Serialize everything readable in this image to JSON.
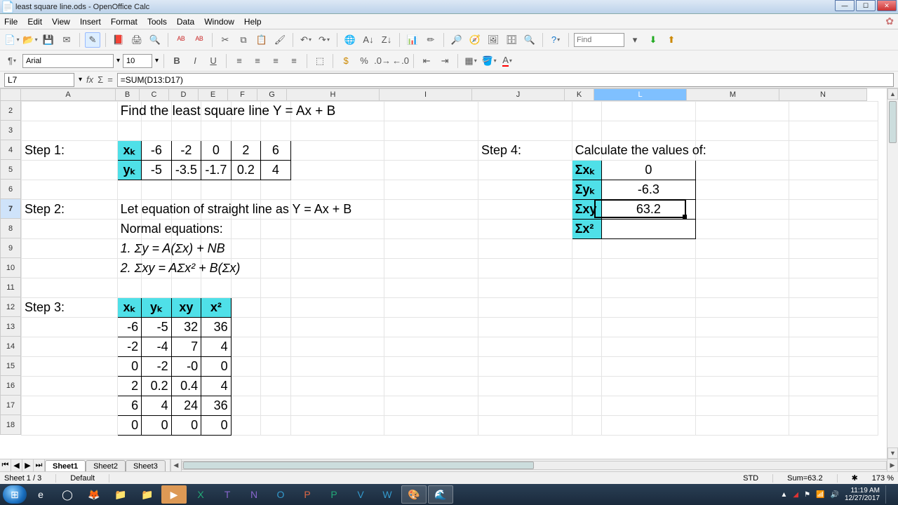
{
  "window": {
    "title": "least square line.ods - OpenOffice Calc"
  },
  "menu": [
    "File",
    "Edit",
    "View",
    "Insert",
    "Format",
    "Tools",
    "Data",
    "Window",
    "Help"
  ],
  "toolbar2": {
    "font_name": "Arial",
    "font_size": "10"
  },
  "find_placeholder": "Find",
  "namebox": "L7",
  "formula": "=SUM(D13:D17)",
  "columns": [
    {
      "l": "A",
      "w": 135
    },
    {
      "l": "B",
      "w": 34
    },
    {
      "l": "C",
      "w": 42
    },
    {
      "l": "D",
      "w": 42
    },
    {
      "l": "E",
      "w": 42
    },
    {
      "l": "F",
      "w": 42
    },
    {
      "l": "G",
      "w": 42
    },
    {
      "l": "H",
      "w": 132
    },
    {
      "l": "I",
      "w": 132
    },
    {
      "l": "J",
      "w": 132
    },
    {
      "l": "K",
      "w": 42
    },
    {
      "l": "L",
      "w": 132
    },
    {
      "l": "M",
      "w": 132
    },
    {
      "l": "N",
      "w": 125
    }
  ],
  "rows": [
    2,
    3,
    4,
    5,
    6,
    7,
    8,
    9,
    10,
    11,
    12,
    13,
    14,
    15,
    16,
    17,
    18
  ],
  "selected_row_index": 5,
  "selected_col": "L",
  "content": {
    "title_text": "Find the least square line Y = Ax + B",
    "step1_label": "Step 1:",
    "step1_xh": "xₖ",
    "step1_yh": "yₖ",
    "step1_x": [
      "-6",
      "-2",
      "0",
      "2",
      "6"
    ],
    "step1_y": [
      "-5",
      "-3.5",
      "-1.7",
      "0.2",
      "4"
    ],
    "step2_label": "Step 2:",
    "step2_l1": "Let equation of straight line as Y = Ax + B",
    "step2_l2": "Normal equations:",
    "step2_l3": "1. Σy = A(Σx) + NB",
    "step2_l4": "2. Σxy = AΣx² + B(Σx)",
    "step3_label": "Step 3:",
    "step3_heads": [
      "xₖ",
      "yₖ",
      "xy",
      "x²"
    ],
    "step3_rows": [
      [
        "-6",
        "-5",
        "32",
        "36"
      ],
      [
        "-2",
        "-4",
        "7",
        "4"
      ],
      [
        "0",
        "-2",
        "-0",
        "0"
      ],
      [
        "2",
        "0.2",
        "0.4",
        "4"
      ],
      [
        "6",
        "4",
        "24",
        "36"
      ],
      [
        "0",
        "0",
        "0",
        "0"
      ]
    ],
    "step4_label": "Step 4:",
    "step4_title": "Calculate the values of:",
    "step4_rows": [
      {
        "h": "Σxₖ",
        "v": "0"
      },
      {
        "h": "Σyₖ",
        "v": "-6.3"
      },
      {
        "h": "Σxy",
        "v": "63.2"
      },
      {
        "h": "Σx²",
        "v": ""
      }
    ]
  },
  "tabs": [
    "Sheet1",
    "Sheet2",
    "Sheet3"
  ],
  "active_tab": 0,
  "status": {
    "sheet": "Sheet 1 / 3",
    "style": "Default",
    "mode": "STD",
    "sum": "Sum=63.2",
    "zoom": "173 %"
  },
  "tray": {
    "time": "11:19 AM",
    "date": "12/27/2017"
  }
}
